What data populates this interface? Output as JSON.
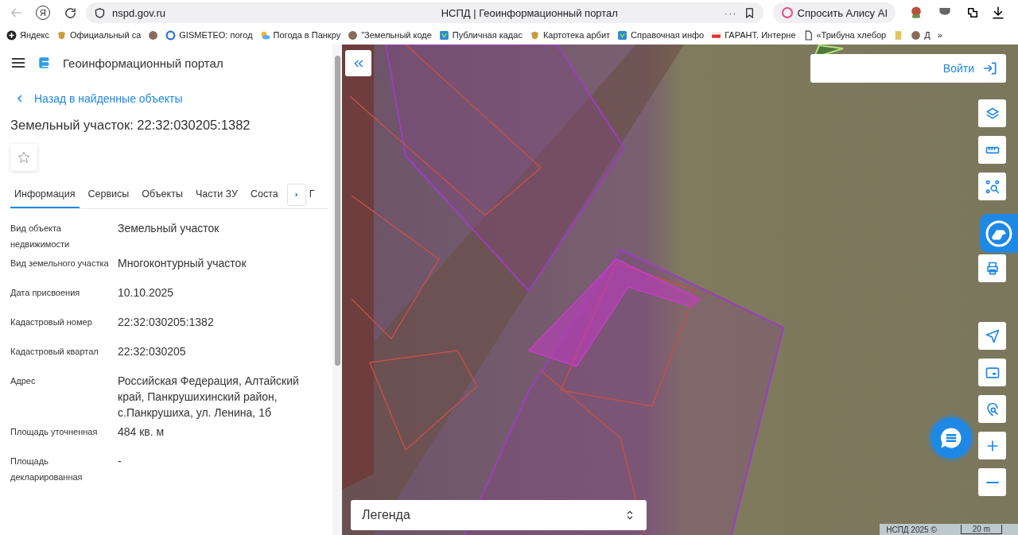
{
  "browser": {
    "back": {
      "disabled": true
    },
    "home_glyph": "Я",
    "address": "nspd.gov.ru",
    "title": "НСПД | Геоинформационный портал",
    "more": "···",
    "alice_button": "Спросить Алису AI",
    "bookmarks": [
      {
        "kind": "yandex",
        "label": "Яндекс"
      },
      {
        "kind": "emblem",
        "label": "Официальный са"
      },
      {
        "kind": "round"
      },
      {
        "kind": "letter",
        "label": "GISMETEO: погод"
      },
      {
        "kind": "weather",
        "label": "Погода в Панкру"
      },
      {
        "kind": "round",
        "label": "\"Земельный коде"
      },
      {
        "kind": "shield",
        "label": "Публичная кадас"
      },
      {
        "kind": "emblem",
        "label": "Картотека арбит"
      },
      {
        "kind": "shield",
        "label": "Справочная инфо"
      },
      {
        "kind": "flag",
        "label": "ГАРАНТ. Интерне"
      },
      {
        "kind": "doc",
        "label": "«Трибуна хлебор"
      },
      {
        "kind": "book"
      },
      {
        "kind": "round",
        "label": "Д"
      }
    ],
    "bookmarks_more": "»"
  },
  "panel": {
    "app_title": "Геоинформационный портал",
    "back_link": "Назад в найденные объекты",
    "heading": "Земельный участок: 22:32:030205:1382",
    "favorite": {
      "on": false
    },
    "tabs": [
      {
        "label": "Информация",
        "selected": true
      },
      {
        "label": "Сервисы",
        "selected": false
      },
      {
        "label": "Объекты",
        "selected": false
      },
      {
        "label": "Части ЗУ",
        "selected": false
      },
      {
        "label": "Соста",
        "selected": false
      },
      {
        "label": "Г",
        "selected": false
      }
    ],
    "rows": [
      {
        "label": "Вид объекта недвижимости",
        "value": "Земельный участок"
      },
      {
        "label": "Вид земельного участка",
        "value": "Многоконтурный участок"
      },
      {
        "label": "Дата присвоения",
        "value": "10.10.2025"
      },
      {
        "label": "Кадастровый номер",
        "value": "22:32:030205:1382"
      },
      {
        "label": "Кадастровый квартал",
        "value": "22:32:030205"
      },
      {
        "label": "Адрес",
        "value": "Российская Федерация, Алтайский край, Панкрушихинский район, с.Панкрушиха, ул. Ленина, 1б"
      },
      {
        "label": "Площадь уточненная",
        "value": "484 кв. м"
      },
      {
        "label": "Площадь декларированная",
        "value": "-"
      }
    ]
  },
  "map": {
    "login_button": "Войти",
    "tools_top": [
      {
        "kind": "layers"
      },
      {
        "kind": "ruler"
      },
      {
        "kind": "area-search"
      },
      {
        "kind": "print"
      }
    ],
    "tools_bottom": [
      {
        "kind": "locate"
      },
      {
        "kind": "minimap"
      },
      {
        "kind": "geo-search"
      },
      {
        "kind": "zoom-in"
      },
      {
        "kind": "zoom-out"
      }
    ],
    "legend": "Легенда",
    "attribution": "НСПД 2025 ©",
    "scale": "20 m"
  }
}
